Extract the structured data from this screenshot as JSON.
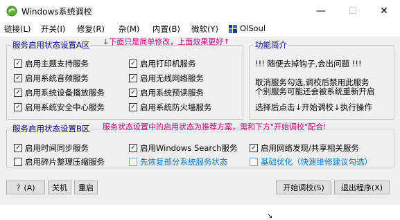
{
  "window": {
    "title": "Windows系统调校",
    "min_glyph": "—",
    "max_glyph": "☐",
    "close_glyph": "✕"
  },
  "menu": [
    "链接(L)",
    "开关(I)",
    "修复(R)",
    "杂(M)",
    "内置(B)",
    "微软(Y)",
    "OlSoul"
  ],
  "group_a": {
    "legend": "服务启用状态设置A区",
    "note": "↓下面只是简单修改，上面效果更好↑",
    "left": [
      {
        "label": "启用主题支持服务",
        "checked": true
      },
      {
        "label": "启用系统音频服务",
        "checked": true
      },
      {
        "label": "启用系统设备播放服务",
        "checked": true
      },
      {
        "label": "启用系统安全中心服务",
        "checked": true
      }
    ],
    "right": [
      {
        "label": "启用打印机服务",
        "checked": true
      },
      {
        "label": "启用无线网络服务",
        "checked": true
      },
      {
        "label": "启用系统预读服务",
        "checked": true
      },
      {
        "label": "启用系统防火墙服务",
        "checked": true
      }
    ]
  },
  "intro": {
    "legend": "功能简介",
    "line1": "!!! 随便去掉钩子,会出问题 !!!",
    "line2": "取消服务勾选,调校后禁用此服务",
    "line3": "个别服务可能还会被系统重新开启",
    "line4": "选择后点击↓开始调校↓执行操作"
  },
  "group_b": {
    "legend": "服务启用状态设置B区",
    "note": "服务状态设置中的启用状态为推荐方案，需和下方\"开始调校\"配合!",
    "items": [
      {
        "label": "启用时间同步服务",
        "checked": true
      },
      {
        "label": "启用Windows Search服务",
        "checked": true
      },
      {
        "label": "启用网络发现/共享相关服务",
        "checked": true
      },
      {
        "label": "启用碎片整理压缩服务",
        "checked": false
      },
      {
        "label": "先恢复部分系统服务状态",
        "checked": false
      },
      {
        "label": "基础优化（快速维修建议勾选）",
        "checked": false
      }
    ]
  },
  "buttons": {
    "help": "？(A)",
    "shutdown": "关机",
    "restart": "重启",
    "start": "开始调校(S)",
    "exit": "退出程序(X)"
  },
  "check_glyph": "✓",
  "cursor_glyph": "↘",
  "colors": {
    "legend": "#000080",
    "note": "#c8007d",
    "blue_option": "#0078d7"
  }
}
